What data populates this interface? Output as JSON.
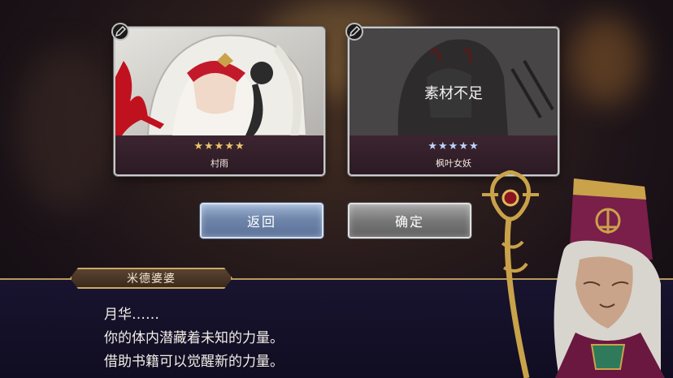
{
  "cards": [
    {
      "name": "村雨",
      "stars": "★★★★★",
      "star_color": "#e9c46a",
      "overlay_text": ""
    },
    {
      "name": "枫叶女妖",
      "stars": "★★★★★",
      "star_color": "#bcd4ff",
      "overlay_text": "素材不足"
    }
  ],
  "buttons": {
    "back": "返回",
    "confirm": "确定"
  },
  "dialog": {
    "speaker": "米德婆婆",
    "lines": [
      "月华……",
      "你的体内潜藏着未知的力量。",
      "借助书籍可以觉醒新的力量。"
    ]
  },
  "colors": {
    "gold_frame": "#c9a963",
    "dialog_bg": "#17142f",
    "back_button": "#7f95bb",
    "confirm_button": "#7a7a7a"
  },
  "icons": [
    "pencil-icon",
    "scepter-icon"
  ]
}
